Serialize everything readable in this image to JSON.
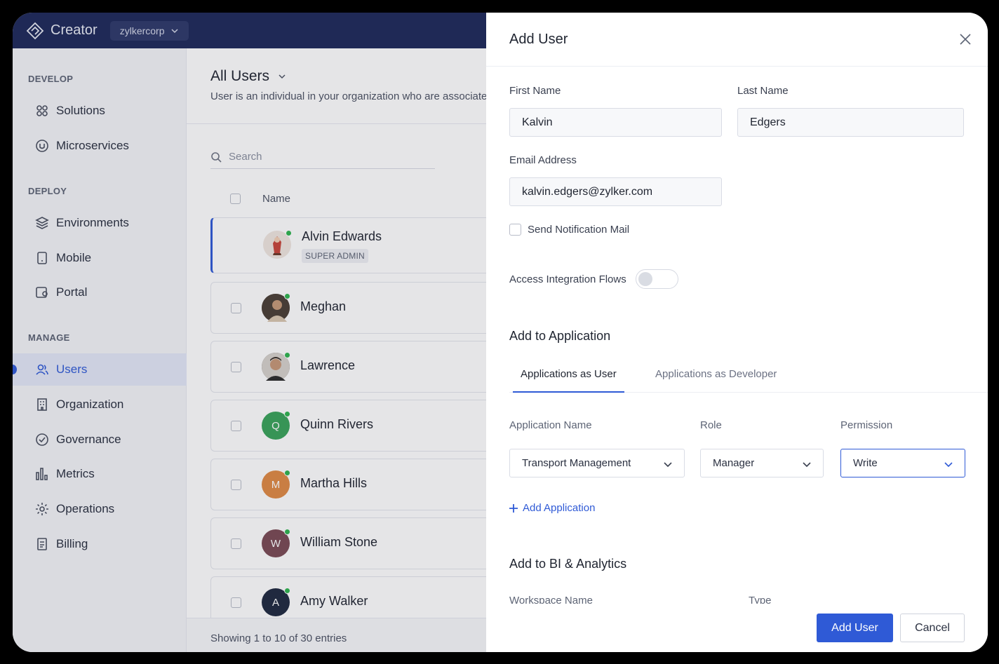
{
  "topbar": {
    "app_name": "Creator",
    "org_name": "zylkercorp"
  },
  "sidebar": {
    "sections": [
      {
        "title": "DEVELOP",
        "items": [
          {
            "label": "Solutions",
            "icon": "solutions-icon"
          },
          {
            "label": "Microservices",
            "icon": "microservices-icon"
          }
        ]
      },
      {
        "title": "DEPLOY",
        "items": [
          {
            "label": "Environments",
            "icon": "environments-icon"
          },
          {
            "label": "Mobile",
            "icon": "mobile-icon"
          },
          {
            "label": "Portal",
            "icon": "portal-icon"
          }
        ]
      },
      {
        "title": "MANAGE",
        "items": [
          {
            "label": "Users",
            "icon": "users-icon",
            "active": true
          },
          {
            "label": "Organization",
            "icon": "organization-icon"
          },
          {
            "label": "Governance",
            "icon": "governance-icon"
          },
          {
            "label": "Metrics",
            "icon": "metrics-icon"
          },
          {
            "label": "Operations",
            "icon": "operations-icon"
          },
          {
            "label": "Billing",
            "icon": "billing-icon"
          }
        ]
      }
    ]
  },
  "main": {
    "title": "All Users",
    "description": "User is an individual in your organization who are associate",
    "search_placeholder": "Search",
    "column_name": "Name",
    "users": [
      {
        "name": "Alvin Edwards",
        "badge": "SUPER ADMIN",
        "avatar": "photo",
        "color": "#e8d9d2"
      },
      {
        "name": "Meghan",
        "avatar": "photo",
        "color": "#6b5a4a"
      },
      {
        "name": "Lawrence",
        "avatar": "photo",
        "color": "#4f4a46"
      },
      {
        "name": "Quinn Rivers",
        "initial": "Q",
        "color": "#3aa35a"
      },
      {
        "name": "Martha Hills",
        "initial": "M",
        "color": "#e08a45"
      },
      {
        "name": "William Stone",
        "initial": "W",
        "color": "#7a4b55"
      },
      {
        "name": "Amy Walker",
        "initial": "A",
        "color": "#1f2a40"
      }
    ],
    "footer": "Showing 1 to 10 of 30 entries"
  },
  "drawer": {
    "title": "Add User",
    "first_name_label": "First Name",
    "first_name_value": "Kalvin",
    "last_name_label": "Last Name",
    "last_name_value": "Edgers",
    "email_label": "Email Address",
    "email_value": "kalvin.edgers@zylker.com",
    "notify_label": "Send Notification Mail",
    "access_flows_label": "Access Integration Flows",
    "add_to_app_title": "Add to Application",
    "tabs": [
      {
        "label": "Applications as User",
        "active": true
      },
      {
        "label": "Applications as Developer",
        "active": false
      }
    ],
    "col_app_name": "Application Name",
    "col_role": "Role",
    "col_permission": "Permission",
    "app_value": "Transport Management",
    "role_value": "Manager",
    "permission_value": "Write",
    "add_application_label": "Add Application",
    "bi_title": "Add to BI & Analytics",
    "bi_col_workspace": "Workspace Name",
    "bi_col_type": "Type",
    "primary_button": "Add User",
    "secondary_button": "Cancel"
  },
  "colors": {
    "accent": "#2f5ad6",
    "topbar": "#1e2a5a",
    "online": "#2fb44f"
  }
}
